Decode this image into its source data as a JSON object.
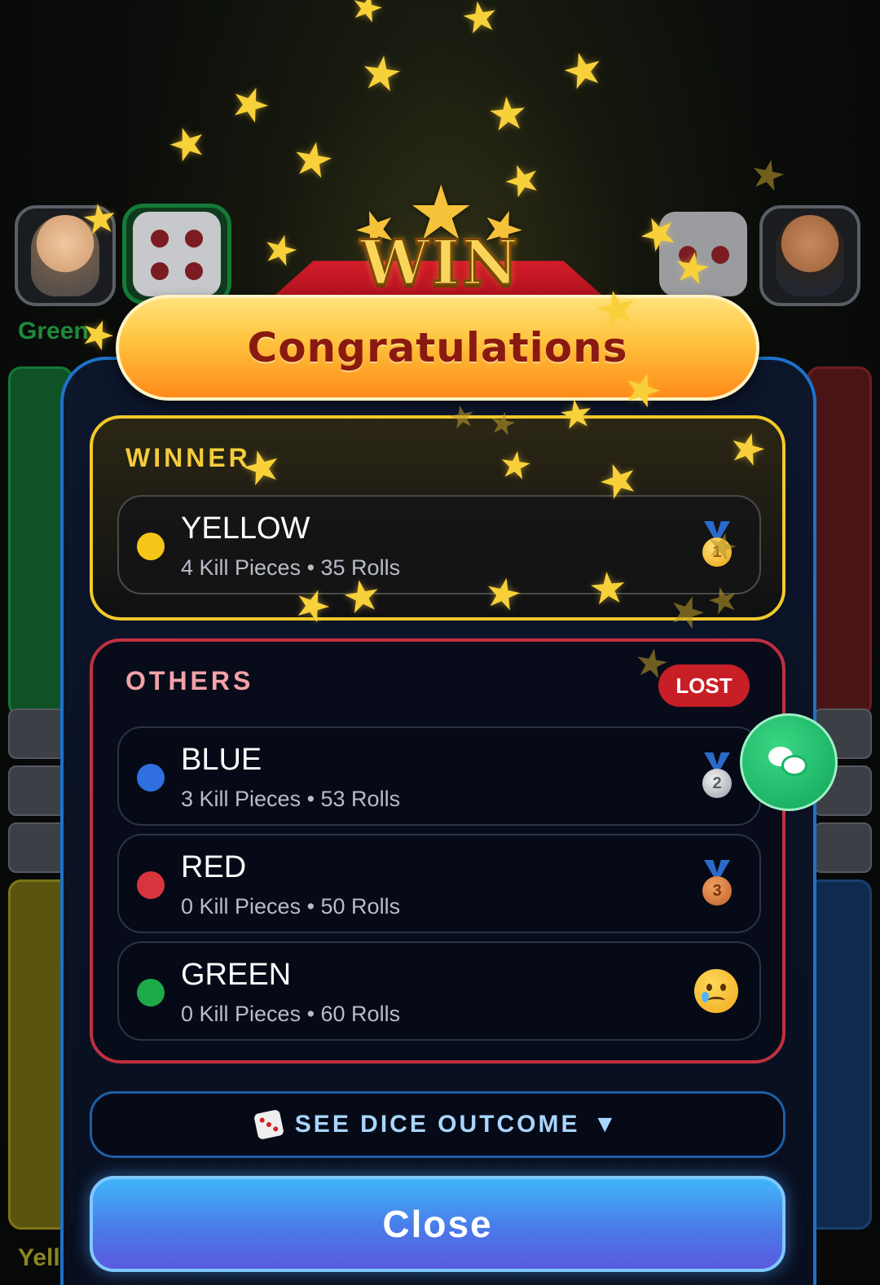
{
  "players_bar": {
    "left_label": "Green",
    "bottom_left_label": "Yell"
  },
  "banner": {
    "win_text": "WIN",
    "title": "Congratulations"
  },
  "winner_section": {
    "title": "WINNER",
    "player": {
      "name": "YELLOW",
      "stats": "4 Kill Pieces • 35 Rolls",
      "color": "#f5c518",
      "medal": "gold-medal-icon",
      "medal_rank": "1"
    }
  },
  "others_section": {
    "title": "OTHERS",
    "badge": "LOST",
    "players": [
      {
        "name": "BLUE",
        "stats": "3 Kill Pieces • 53 Rolls",
        "color": "#2f6fe0",
        "medal": "silver-medal-icon",
        "medal_rank": "2"
      },
      {
        "name": "RED",
        "stats": "0 Kill Pieces • 50 Rolls",
        "color": "#d8343e",
        "medal": "bronze-medal-icon",
        "medal_rank": "3"
      },
      {
        "name": "GREEN",
        "stats": "0 Kill Pieces • 60 Rolls",
        "color": "#1faa4a",
        "medal": "crying-face-icon"
      }
    ]
  },
  "dice_outcome": {
    "label": "SEE DICE OUTCOME",
    "caret": "▼",
    "icon": "dice-icon"
  },
  "close_button": {
    "label": "Close"
  },
  "chat_button": {
    "icon": "chat-icon"
  },
  "colors": {
    "winner_border": "#f2c92a",
    "others_border": "#c03040",
    "modal_border": "#1d72c9",
    "lost_badge": "#c81e26"
  }
}
